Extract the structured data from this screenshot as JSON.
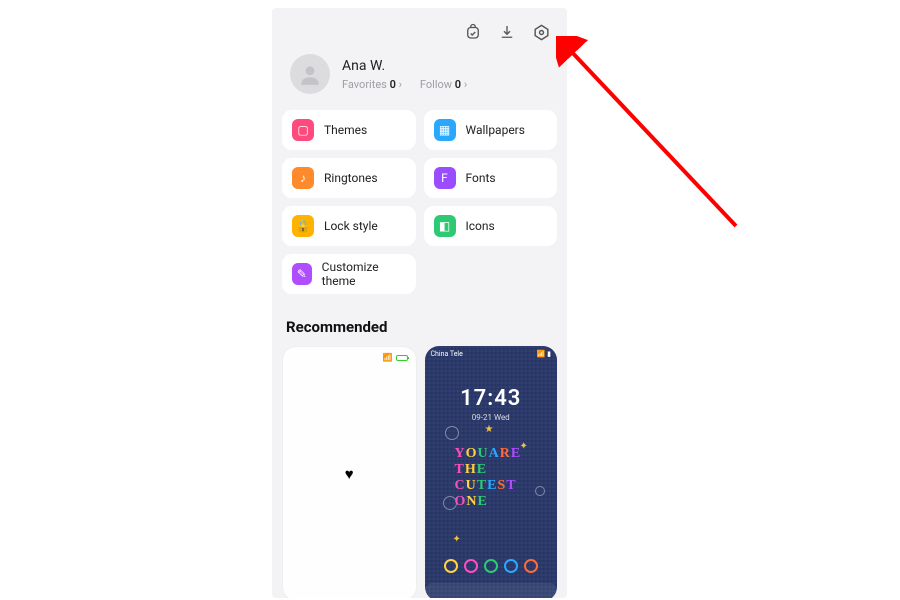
{
  "topbar": {
    "icons": [
      "bag-icon",
      "download-icon",
      "settings-icon"
    ]
  },
  "profile": {
    "name": "Ana W.",
    "favorites_label": "Favorites",
    "favorites_count": "0",
    "follow_label": "Follow",
    "follow_count": "0"
  },
  "tiles": [
    {
      "label": "Themes",
      "icon": "themes",
      "color": "#ff4a7d"
    },
    {
      "label": "Wallpapers",
      "icon": "wallpapers",
      "color": "#2aa8ff"
    },
    {
      "label": "Ringtones",
      "icon": "ringtones",
      "color": "#ff8a2b"
    },
    {
      "label": "Fonts",
      "icon": "fonts",
      "color": "#9a4dff"
    },
    {
      "label": "Lock style",
      "icon": "lockstyle",
      "color": "#ffb300"
    },
    {
      "label": "Icons",
      "icon": "icons",
      "color": "#2ec973"
    },
    {
      "label": "Customize theme",
      "icon": "customize",
      "color": "#b04dff"
    }
  ],
  "recommended": {
    "heading": "Recommended",
    "cards": [
      {
        "kind": "heart"
      },
      {
        "kind": "denim",
        "carrier": "China Tele",
        "time": "17:43",
        "date": "09-21  Wed",
        "text": "YOUARE THE CUTEST ONE",
        "smilies": [
          "#ffd23f",
          "#ff4dbf",
          "#2ec973",
          "#2aa8ff",
          "#ff6a3d"
        ]
      }
    ]
  }
}
